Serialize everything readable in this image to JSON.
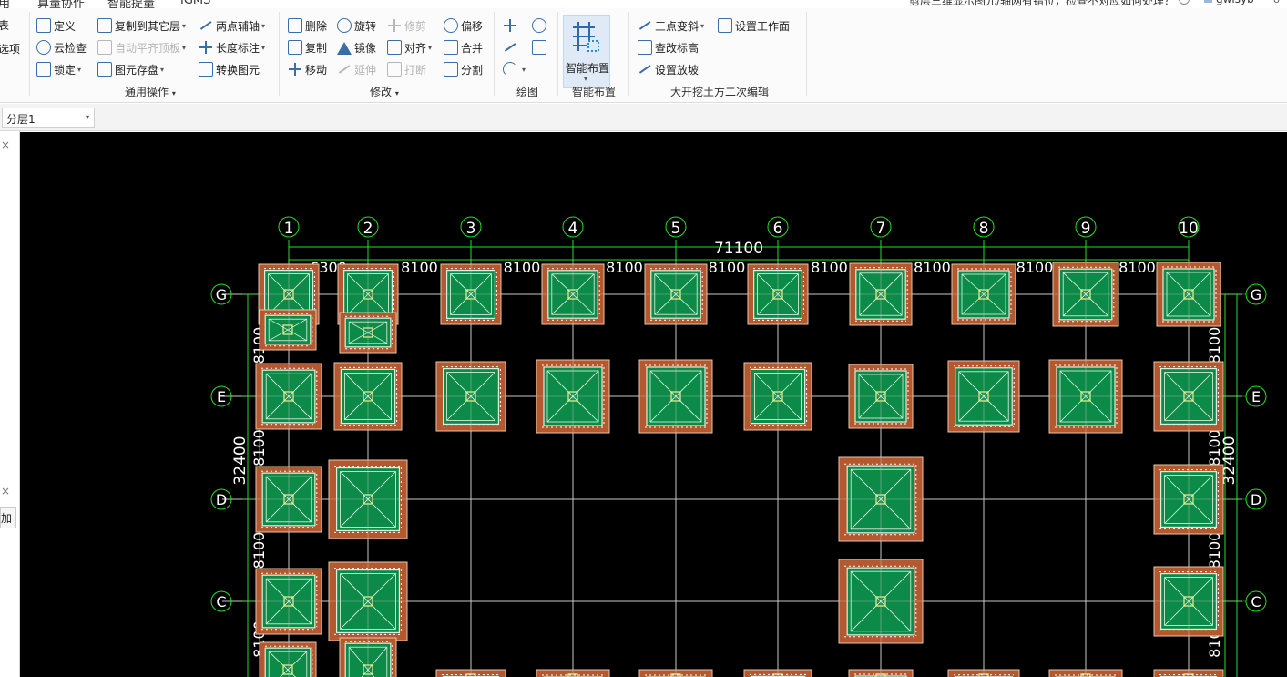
{
  "menu": {
    "items": [
      "用",
      "算量协作",
      "智能提量",
      "IGMS"
    ],
    "question": "剪层三维显示图元/轴网有错位，检查不对应如何处理？",
    "user": "gwlsyb",
    "extra": "8"
  },
  "ribbon": {
    "left_fragments": [
      "表",
      "选项"
    ],
    "general": {
      "label": "通用操作",
      "define": "定义",
      "cloud_check": "云检查",
      "lock": "锁定",
      "copy_to_layer": "复制到其它层",
      "auto_flush": "自动平齐顶板",
      "save_elements": "图元存盘",
      "two_point_axis": "两点辅轴",
      "length_dim": "长度标注",
      "convert": "转换图元"
    },
    "modify": {
      "label": "修改",
      "delete": "删除",
      "rotate": "旋转",
      "trim": "修剪",
      "offset": "偏移",
      "copy": "复制",
      "mirror": "镜像",
      "align": "对齐",
      "merge": "合并",
      "move": "移动",
      "extend": "延伸",
      "break": "打断",
      "split": "分割"
    },
    "draw": {
      "label": "绘图"
    },
    "smart": {
      "label": "智能布置",
      "button": "智能布置"
    },
    "earthwork": {
      "label": "大开挖土方二次编辑",
      "three_point": "三点变斜",
      "set_work_plane": "设置工作面",
      "check_elevation": "查改标高",
      "set_slope": "设置放坡"
    }
  },
  "layer_select": {
    "value": "分层1"
  },
  "left_panel": {
    "close": "×",
    "button_fragment": "加",
    "collapse": "<"
  },
  "drawing": {
    "axes_x": [
      "1",
      "2",
      "3",
      "4",
      "5",
      "6",
      "7",
      "8",
      "9",
      "10"
    ],
    "axes_y": [
      "G",
      "E",
      "D",
      "C"
    ],
    "total_length": "71100",
    "spans_x": [
      "6300",
      "8100",
      "8100",
      "8100",
      "8100",
      "8100",
      "8100",
      "8100",
      "8100"
    ],
    "total_height": "32400",
    "spans_y": [
      "8100",
      "8100",
      "8100",
      "8100"
    ],
    "colors": {
      "background": "#000000",
      "foundation_outer": "#b4592f",
      "foundation_inner": "#0b8a48",
      "axis_line": "#c8c8c8",
      "dimension": "#23e023",
      "text": "#ffffff"
    }
  }
}
